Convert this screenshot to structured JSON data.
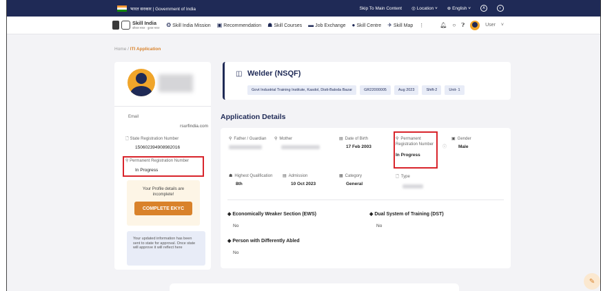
{
  "topbar": {
    "gov_text": "भारत सरकार | Government of India",
    "skip": "Skip To Main Content",
    "location": "Location",
    "language": "English",
    "a_icon": "A"
  },
  "navbar": {
    "brand": "Skill India",
    "brand_sub": "कौशल भारत · कुशल भारत",
    "links": [
      "Skill India Mission",
      "Recommendation",
      "Skill Courses",
      "Job Exchange",
      "Skill Centre",
      "Skill Map"
    ],
    "user_label": "User"
  },
  "breadcrumb": {
    "home": "Home",
    "sep": "/",
    "current": "ITI Application"
  },
  "profile": {
    "email_label": "Email",
    "email_value": "rsurfindia.com",
    "state_reg_label": "State Registration Number",
    "state_reg_value": "150602394908982016",
    "prn_label": "Permanent Registration Number",
    "prn_value": "In Progress",
    "incomplete_msg": "Your Profile details are incomplete!",
    "ekyc_button": "COMPLETE EKYC",
    "info_msg": "Your updated information has been sent to state for approval. Once state will approve it will reflect here"
  },
  "course": {
    "title": "Welder (NSQF)",
    "chips": [
      "Govt Industrial Training Institute, Kasdol, Distt-Baloda Bazar",
      "GR22000005",
      "Aug 2023",
      "Shift-2",
      "Unit- 1"
    ]
  },
  "application": {
    "heading": "Application Details",
    "father_label": "Father / Guardian",
    "mother_label": "Mother",
    "dob_label": "Date of Birth",
    "dob_value": "17 Feb 2003",
    "prn_label": "Permanent Registration Number",
    "prn_value": "In Progress",
    "gender_label": "Gender",
    "gender_value": "Male",
    "qual_label": "Highest Qualification",
    "qual_value": "8th",
    "admission_label": "Admission",
    "admission_value": "10 Oct 2023",
    "category_label": "Category",
    "category_value": "General",
    "type_label": "Type",
    "ews_label": "Economically Weaker Section (EWS)",
    "ews_value": "No",
    "dst_label": "Dual System of Training (DST)",
    "dst_value": "No",
    "pwd_label": "Person with Differently Abled",
    "pwd_value": "No"
  },
  "colors": {
    "navy": "#1f2a56",
    "orange": "#d9822b",
    "highlight": "#d8232a"
  }
}
